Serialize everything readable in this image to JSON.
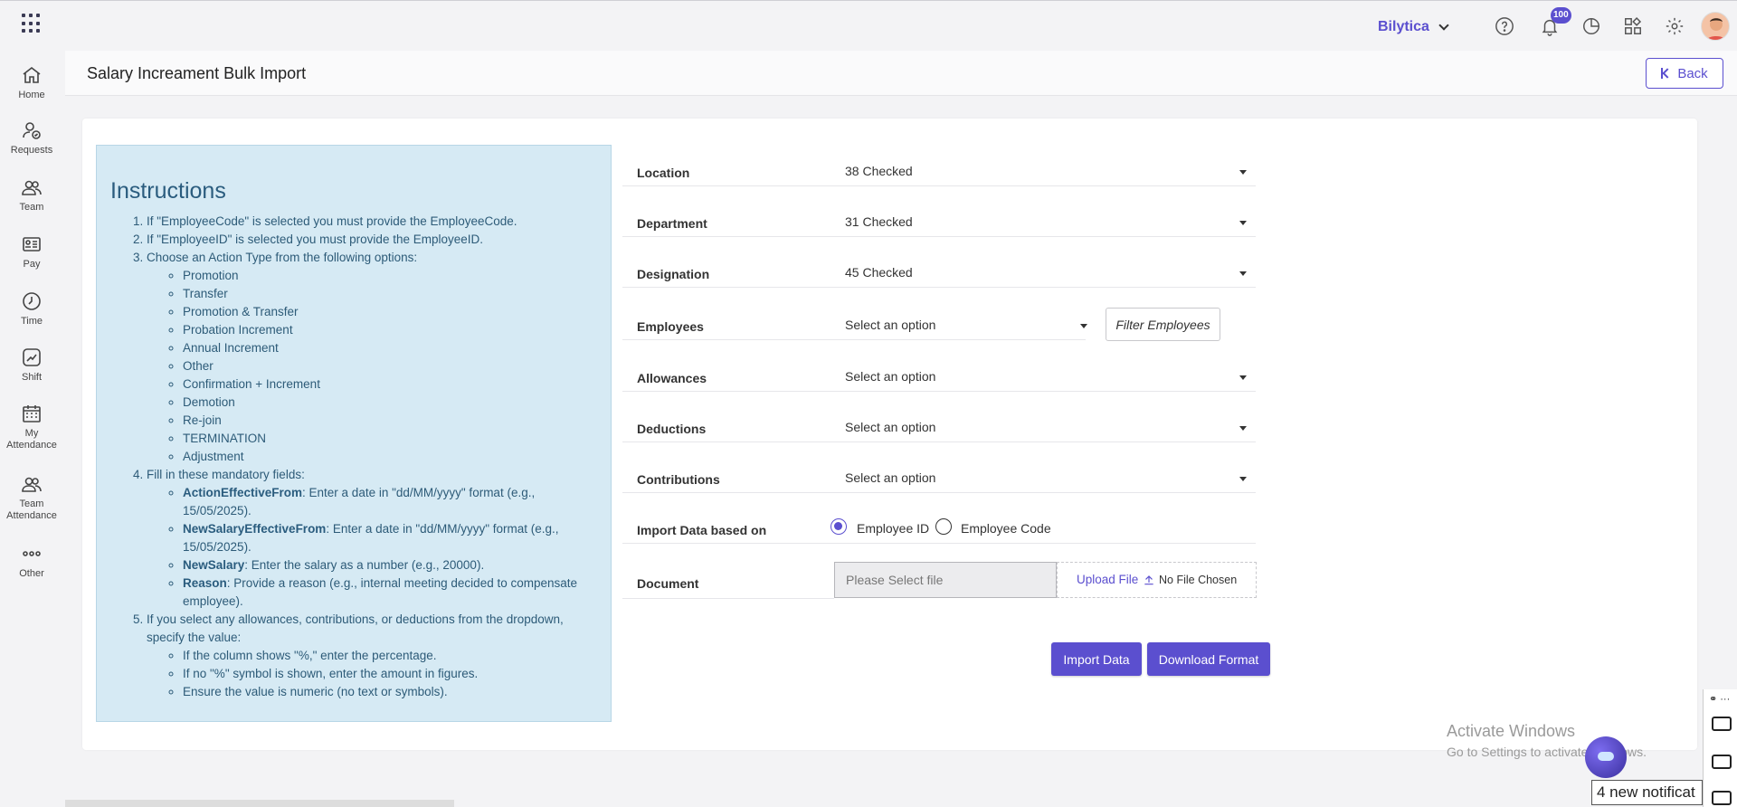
{
  "topbar": {
    "company": "Bilytica",
    "notification_count": "100"
  },
  "sidebar": {
    "items": [
      {
        "label": "Home",
        "icon": "home-icon"
      },
      {
        "label": "Requests",
        "icon": "user-check-icon"
      },
      {
        "label": "Team",
        "icon": "team-icon"
      },
      {
        "label": "Pay",
        "icon": "id-card-icon"
      },
      {
        "label": "Time",
        "icon": "clock-icon"
      },
      {
        "label": "Shift",
        "icon": "shift-icon"
      },
      {
        "label": "My\nAttendance",
        "line1": "My",
        "line2": "Attendance",
        "icon": "calendar-icon"
      },
      {
        "label": "Team\nAttendance",
        "line1": "Team",
        "line2": "Attendance",
        "icon": "team-attendance-icon"
      },
      {
        "label": "Other",
        "icon": "more-icon"
      }
    ]
  },
  "header": {
    "title": "Salary Increament Bulk Import",
    "back_label": "Back"
  },
  "instructions": {
    "title": "Instructions",
    "step1": "If \"EmployeeCode\" is selected you must provide the EmployeeCode.",
    "step2": "If \"EmployeeID\" is selected you must provide the EmployeeID.",
    "step3": "Choose an Action Type from the following options:",
    "action_types": [
      "Promotion",
      "Transfer",
      "Promotion & Transfer",
      "Probation Increment",
      "Annual Increment",
      "Other",
      "Confirmation + Increment",
      "Demotion",
      "Re-join",
      "TERMINATION",
      "Adjustment"
    ],
    "step4": "Fill in these mandatory fields:",
    "fields": [
      {
        "name": "ActionEffectiveFrom",
        "desc": ": Enter a date in \"dd/MM/yyyy\" format (e.g., 15/05/2025)."
      },
      {
        "name": "NewSalaryEffectiveFrom",
        "desc": ": Enter a date in \"dd/MM/yyyy\" format (e.g., 15/05/2025)."
      },
      {
        "name": "NewSalary",
        "desc": ": Enter the salary as a number (e.g., 20000)."
      },
      {
        "name": "Reason",
        "desc": ": Provide a reason (e.g., internal meeting decided to compensate employee)."
      }
    ],
    "step5": "If you select any allowances, contributions, or deductions from the dropdown, specify the value:",
    "value_rules": [
      "If the column shows \"%,\" enter the percentage.",
      "If no \"%\" symbol is shown, enter the amount in figures.",
      "Ensure the value is numeric (no text or symbols)."
    ]
  },
  "form": {
    "location": {
      "label": "Location",
      "value": "38 Checked"
    },
    "department": {
      "label": "Department",
      "value": "31 Checked"
    },
    "designation": {
      "label": "Designation",
      "value": "45 Checked"
    },
    "employees": {
      "label": "Employees",
      "value": "Select an option"
    },
    "filter_label": "Filter Employees",
    "allowances": {
      "label": "Allowances",
      "value": "Select an option"
    },
    "deductions": {
      "label": "Deductions",
      "value": "Select an option"
    },
    "contributions": {
      "label": "Contributions",
      "value": "Select an option"
    },
    "import_based_label": "Import Data based on",
    "radio_employee_id": "Employee ID",
    "radio_employee_code": "Employee Code",
    "document_label": "Document",
    "file_placeholder": "Please Select file",
    "upload_label": "Upload File",
    "no_file": "No File Chosen",
    "import_btn": "Import Data",
    "download_btn": "Download Format"
  },
  "overlay": {
    "activate_title": "Activate Windows",
    "activate_sub": "Go to Settings to activate Windows.",
    "toast": "4 new notificat"
  },
  "colors": {
    "accent": "#5b4fcf",
    "instructions_bg": "#d6eaf4"
  }
}
